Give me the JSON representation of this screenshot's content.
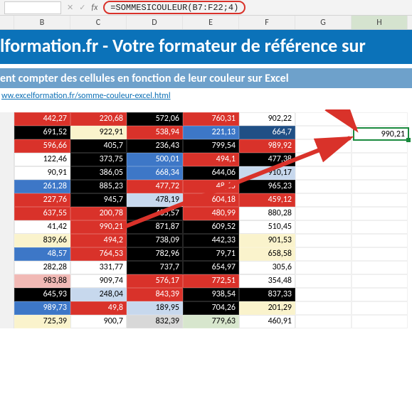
{
  "formula_bar": {
    "namebox": "",
    "fx_label": "fx",
    "formula": "=SOMMESICOULEUR(B7:F22;4)"
  },
  "column_headers": [
    "B",
    "C",
    "D",
    "E",
    "F",
    "G",
    "H"
  ],
  "title1": "lformation.fr - Votre formateur de référence sur",
  "title2": "ent compter des cellules en fonction de leur couleur sur Excel",
  "link": "ww.excelformation.fr/somme-couleur-excel.html",
  "result_cell": "990,21",
  "colors": {
    "result_border": "#1a8a3e",
    "formula_border": "#d9322a",
    "arrow": "#d9322a"
  },
  "chart_data": {
    "type": "table",
    "columns": [
      "B",
      "C",
      "D",
      "E",
      "F"
    ],
    "rows": [
      [
        {
          "v": "442,27",
          "c": "red"
        },
        {
          "v": "220,68",
          "c": "red"
        },
        {
          "v": "572,06",
          "c": "black"
        },
        {
          "v": "760,31",
          "c": "red"
        },
        {
          "v": "902,22",
          "c": "white"
        }
      ],
      [
        {
          "v": "691,52",
          "c": "black"
        },
        {
          "v": "922,91",
          "c": "lyellow"
        },
        {
          "v": "538,94",
          "c": "red"
        },
        {
          "v": "221,13",
          "c": "blue"
        },
        {
          "v": "664,7",
          "c": "dblue"
        }
      ],
      [
        {
          "v": "596,66",
          "c": "red"
        },
        {
          "v": "405,7",
          "c": "black"
        },
        {
          "v": "236,43",
          "c": "black"
        },
        {
          "v": "799,54",
          "c": "black"
        },
        {
          "v": "989,92",
          "c": "red"
        }
      ],
      [
        {
          "v": "122,46",
          "c": "white"
        },
        {
          "v": "373,75",
          "c": "black"
        },
        {
          "v": "500,01",
          "c": "blue"
        },
        {
          "v": "494,1",
          "c": "red"
        },
        {
          "v": "477,38",
          "c": "black"
        }
      ],
      [
        {
          "v": "90,91",
          "c": "white"
        },
        {
          "v": "386,05",
          "c": "black"
        },
        {
          "v": "668,34",
          "c": "blue"
        },
        {
          "v": "644,06",
          "c": "black"
        },
        {
          "v": "910,17",
          "c": "lblue"
        }
      ],
      [
        {
          "v": "261,28",
          "c": "blue"
        },
        {
          "v": "885,23",
          "c": "black"
        },
        {
          "v": "477,72",
          "c": "red"
        },
        {
          "v": "48,65",
          "c": "red"
        },
        {
          "v": "965,23",
          "c": "black"
        }
      ],
      [
        {
          "v": "227,76",
          "c": "red"
        },
        {
          "v": "945,7",
          "c": "black"
        },
        {
          "v": "478,19",
          "c": "lblue"
        },
        {
          "v": "604,18",
          "c": "red"
        },
        {
          "v": "459,12",
          "c": "red"
        }
      ],
      [
        {
          "v": "637,55",
          "c": "red"
        },
        {
          "v": "200,78",
          "c": "red"
        },
        {
          "v": "485,57",
          "c": "black"
        },
        {
          "v": "480,99",
          "c": "red"
        },
        {
          "v": "880,28",
          "c": "white"
        }
      ],
      [
        {
          "v": "41,42",
          "c": "white"
        },
        {
          "v": "990,21",
          "c": "red"
        },
        {
          "v": "871,87",
          "c": "black"
        },
        {
          "v": "609,52",
          "c": "black"
        },
        {
          "v": "510,45",
          "c": "white"
        }
      ],
      [
        {
          "v": "839,66",
          "c": "lyellow"
        },
        {
          "v": "494,2",
          "c": "red"
        },
        {
          "v": "738,09",
          "c": "black"
        },
        {
          "v": "442,33",
          "c": "black"
        },
        {
          "v": "901,53",
          "c": "lyellow"
        }
      ],
      [
        {
          "v": "48,57",
          "c": "blue"
        },
        {
          "v": "764,53",
          "c": "red"
        },
        {
          "v": "782,96",
          "c": "black"
        },
        {
          "v": "79,71",
          "c": "black"
        },
        {
          "v": "658,58",
          "c": "lyellow"
        }
      ],
      [
        {
          "v": "282,28",
          "c": "white"
        },
        {
          "v": "331,77",
          "c": "white"
        },
        {
          "v": "737,7",
          "c": "black"
        },
        {
          "v": "654,97",
          "c": "black"
        },
        {
          "v": "305,6",
          "c": "white"
        }
      ],
      [
        {
          "v": "983,88",
          "c": "pink"
        },
        {
          "v": "909,74",
          "c": "white"
        },
        {
          "v": "576,17",
          "c": "red"
        },
        {
          "v": "772,51",
          "c": "red"
        },
        {
          "v": "354,48",
          "c": "white"
        }
      ],
      [
        {
          "v": "645,93",
          "c": "black"
        },
        {
          "v": "248,04",
          "c": "lblue"
        },
        {
          "v": "843,39",
          "c": "red"
        },
        {
          "v": "938,54",
          "c": "black"
        },
        {
          "v": "837,33",
          "c": "black"
        }
      ],
      [
        {
          "v": "989,73",
          "c": "blue"
        },
        {
          "v": "49,8",
          "c": "red"
        },
        {
          "v": "189,95",
          "c": "lblue"
        },
        {
          "v": "704,26",
          "c": "black"
        },
        {
          "v": "201,29",
          "c": "lyellow"
        }
      ],
      [
        {
          "v": "725,39",
          "c": "lyellow"
        },
        {
          "v": "900,7",
          "c": "white"
        },
        {
          "v": "832,39",
          "c": "grey"
        },
        {
          "v": "779,63",
          "c": "lgreen"
        },
        {
          "v": "460,91",
          "c": "white"
        }
      ]
    ]
  }
}
